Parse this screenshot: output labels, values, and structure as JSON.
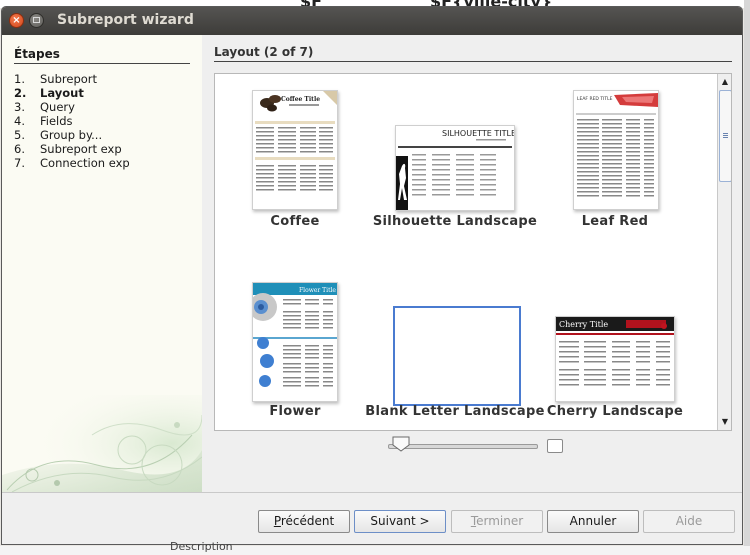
{
  "window": {
    "title": "Subreport wizard"
  },
  "steps": {
    "heading": "Étapes",
    "items": [
      {
        "num": "1.",
        "label": "Subreport",
        "active": false
      },
      {
        "num": "2.",
        "label": "Layout",
        "active": true
      },
      {
        "num": "3.",
        "label": "Query",
        "active": false
      },
      {
        "num": "4.",
        "label": "Fields",
        "active": false
      },
      {
        "num": "5.",
        "label": "Group by...",
        "active": false
      },
      {
        "num": "6.",
        "label": "Subreport exp",
        "active": false
      },
      {
        "num": "7.",
        "label": "Connection exp",
        "active": false
      }
    ]
  },
  "content": {
    "title": "Layout (2 of 7)",
    "layouts": [
      {
        "label": "Coffee",
        "thumb_title": "Coffee Title"
      },
      {
        "label": "Silhouette Landscape",
        "thumb_title": "SILHOUETTE TITLE"
      },
      {
        "label": "Leaf Red",
        "thumb_title": "LEAF RED TITLE"
      },
      {
        "label": "Flower",
        "thumb_title": "Flower Title"
      },
      {
        "label": "Blank Letter Landscape",
        "thumb_title": ""
      },
      {
        "label": "Cherry Landscape",
        "thumb_title": "Cherry Title"
      }
    ],
    "selected": "Blank Letter Landscape"
  },
  "zoom": {
    "level": 0.1
  },
  "buttons": {
    "previous": {
      "pre": "",
      "u": "P",
      "post": "récédent"
    },
    "next": "Suivant >",
    "finish": {
      "pre": "",
      "u": "T",
      "post": "erminer"
    },
    "cancel": "Annuler",
    "help": "Aide"
  },
  "background": {
    "top_text_left": "$F",
    "top_text_right": "$F{ville-city}",
    "bottom_text": "Description"
  },
  "colors": {
    "accent": "#4a7bd0",
    "close": "#d2471b",
    "titlebar": "#3d3c39"
  }
}
